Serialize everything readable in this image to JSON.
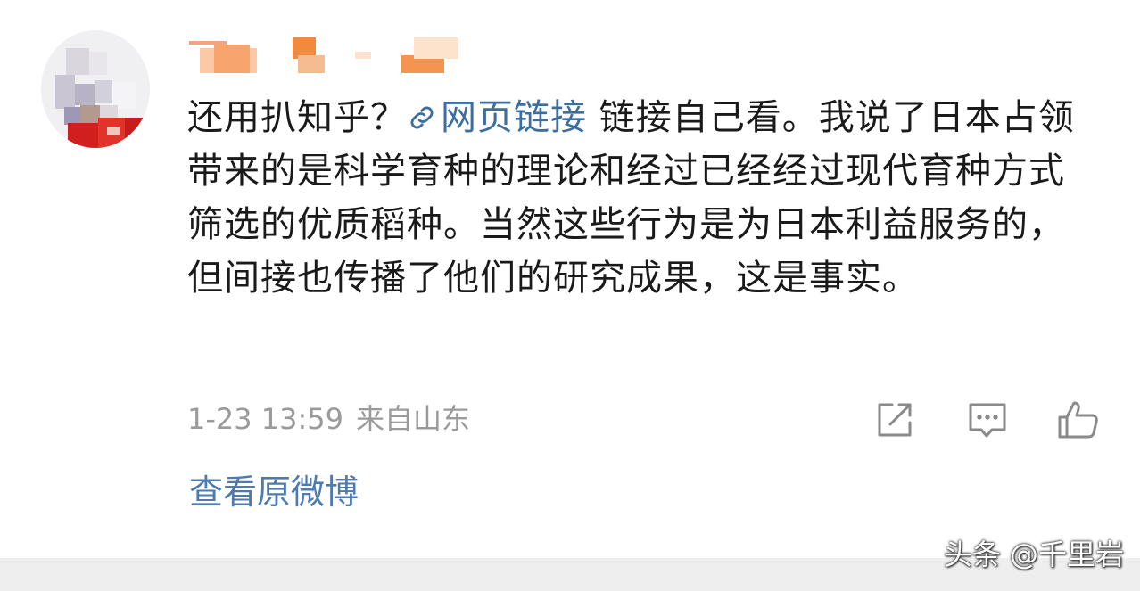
{
  "comment": {
    "prefix": "还用扒知乎？",
    "link_label": "网页链接",
    "body": "链接自己看。我说了日本占领带来的是科学育种的理论和经过已经经过现代育种方式筛选的优质稻种。当然这些行为是为日本利益服务的，但间接也传播了他们的研究成果，这是事实。"
  },
  "meta": {
    "timestamp": "1-23 13:59",
    "location": "来自山东"
  },
  "actions": {
    "share_icon": "share-icon",
    "reply_icon": "comment-icon",
    "like_icon": "thumbs-up-icon"
  },
  "view_original": "查看原微博",
  "watermark": "头条 @千里岩",
  "colors": {
    "text": "#1a1a1a",
    "link": "#3c6e9e",
    "meta": "#9b9b9b",
    "view_original": "#4f7ab0"
  }
}
